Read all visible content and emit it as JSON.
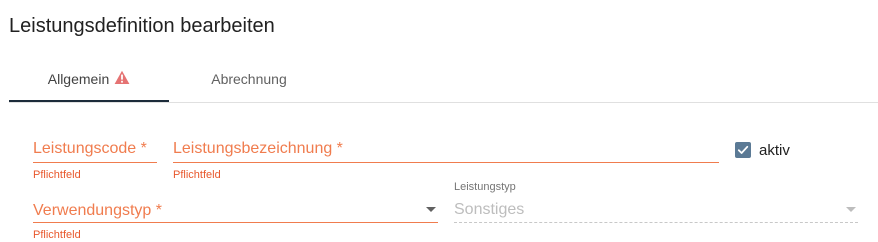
{
  "page": {
    "title": "Leistungsdefinition bearbeiten"
  },
  "tabs": [
    {
      "label": "Allgemein",
      "active": true,
      "has_warning": true
    },
    {
      "label": "Abrechnung",
      "active": false,
      "has_warning": false
    }
  ],
  "form": {
    "code": {
      "label": "Leistungscode *",
      "value": "",
      "error": "Pflichtfeld"
    },
    "name": {
      "label": "Leistungsbezeichnung *",
      "value": "",
      "error": "Pflichtfeld"
    },
    "active": {
      "label": "aktiv",
      "checked": true
    },
    "usage_type": {
      "label": "Verwendungstyp *",
      "value": "",
      "error": "Pflichtfeld"
    },
    "service_type": {
      "label": "Leistungstyp",
      "value": "Sonstiges",
      "disabled": true
    }
  },
  "colors": {
    "error": "#f07c4e",
    "active_tab_indicator": "#1c2b3a",
    "checkbox": "#5b7a95",
    "warning_icon": "#e57373"
  },
  "icons": {
    "tab_warning": "warning-triangle-icon",
    "dropdown": "chevron-down-icon",
    "checkbox": "check-icon"
  }
}
